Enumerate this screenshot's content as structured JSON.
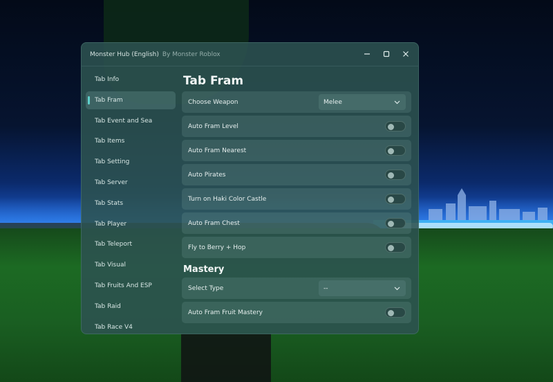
{
  "window": {
    "title": "Monster Hub (English)",
    "subtitle": "By Monster Roblox",
    "controls": {
      "minimize_icon": "minimize-icon",
      "maximize_icon": "maximize-icon",
      "close_icon": "close-icon"
    }
  },
  "sidebar": {
    "items": [
      {
        "label": "Tab Info",
        "active": false
      },
      {
        "label": "Tab Fram",
        "active": true
      },
      {
        "label": "Tab Event and Sea",
        "active": false
      },
      {
        "label": "Tab Items",
        "active": false
      },
      {
        "label": "Tab Setting",
        "active": false
      },
      {
        "label": "Tab Server",
        "active": false
      },
      {
        "label": "Tab Stats",
        "active": false
      },
      {
        "label": "Tab Player",
        "active": false
      },
      {
        "label": "Tab Teleport",
        "active": false
      },
      {
        "label": "Tab Visual",
        "active": false
      },
      {
        "label": "Tab Fruits And ESP",
        "active": false
      },
      {
        "label": "Tab Raid",
        "active": false
      },
      {
        "label": "Tab Race V4",
        "active": false
      }
    ]
  },
  "main": {
    "title": "Tab Fram",
    "choose_weapon": {
      "label": "Choose Weapon",
      "value": "Melee"
    },
    "toggles": [
      {
        "label": "Auto Fram Level",
        "on": false
      },
      {
        "label": "Auto Fram Nearest",
        "on": false
      },
      {
        "label": "Auto Pirates",
        "on": false
      },
      {
        "label": "Turn on Haki Color Castle",
        "on": false
      },
      {
        "label": "Auto Fram Chest",
        "on": false
      },
      {
        "label": "Fly to Berry + Hop",
        "on": false
      }
    ],
    "mastery": {
      "title": "Mastery",
      "select_type": {
        "label": "Select Type",
        "value": "--"
      },
      "toggles": [
        {
          "label": "Auto Fram Fruit Mastery",
          "on": false
        }
      ]
    }
  },
  "colors": {
    "accent": "#5fd0cc",
    "window_bg": "#2c5250",
    "row_bg": "#4f7572"
  }
}
